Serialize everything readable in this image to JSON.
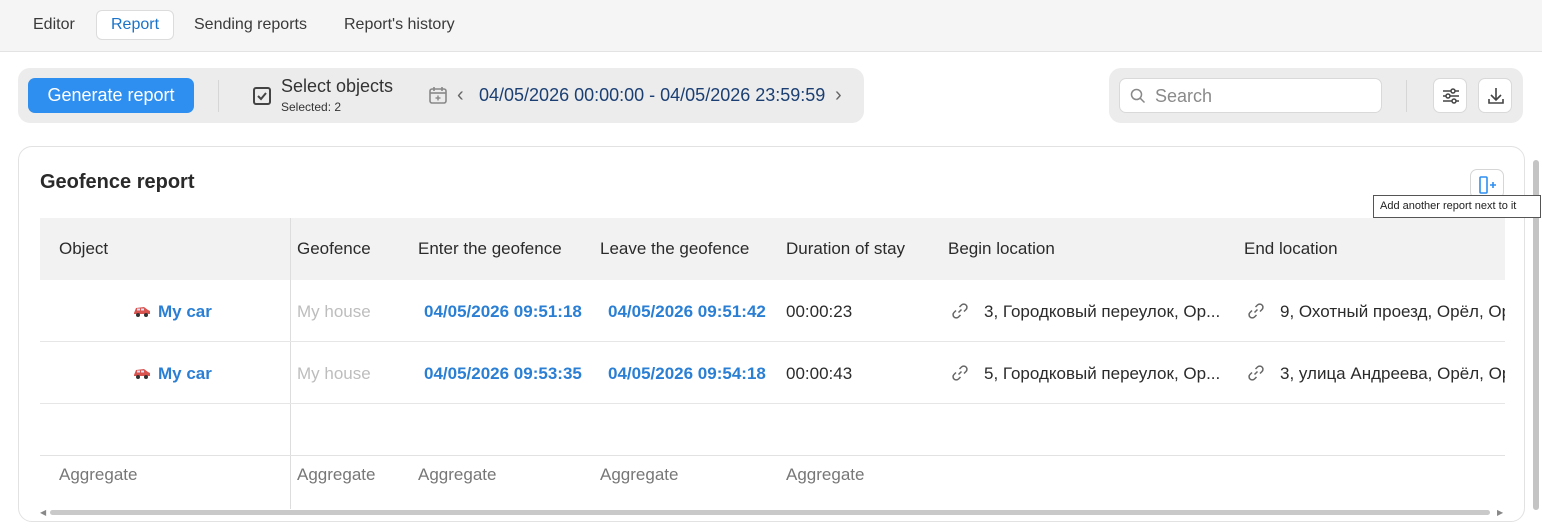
{
  "tabs": [
    {
      "label": "Editor",
      "active": false
    },
    {
      "label": "Report",
      "active": true
    },
    {
      "label": "Sending reports",
      "active": false
    },
    {
      "label": "Report's history",
      "active": false
    }
  ],
  "toolbar": {
    "generate_label": "Generate report",
    "select_objects_label": "Select objects",
    "selected_count_label": "Selected: 2",
    "period_label": "04/05/2026 00:00:00 - 04/05/2026 23:59:59",
    "search_placeholder": "Search",
    "accent_color": "#2e8ff0"
  },
  "report": {
    "title": "Geofence report",
    "add_tooltip": "Add another report next to it",
    "columns": [
      "Object",
      "Geofence",
      "Enter the geofence",
      "Leave the geofence",
      "Duration of stay",
      "Begin location",
      "End location"
    ],
    "rows": [
      {
        "object": "My car",
        "geofence": "My house",
        "enter": "04/05/2026 09:51:18",
        "leave": "04/05/2026 09:51:42",
        "duration": "00:00:23",
        "begin_location": "3, Городковый переулок, Ор...",
        "end_location": "9, Охотный проезд, Орёл, Ор"
      },
      {
        "object": "My car",
        "geofence": "My house",
        "enter": "04/05/2026 09:53:35",
        "leave": "04/05/2026 09:54:18",
        "duration": "00:00:43",
        "begin_location": "5, Городковый переулок, Ор...",
        "end_location": "3, улица Андреева, Орёл, Ор"
      }
    ],
    "aggregate_label": "Aggregate"
  },
  "icons": {
    "checkbox": "checkbox-checked-icon",
    "calendar": "calendar-icon",
    "prev": "chevron-left-icon",
    "next": "chevron-right-icon",
    "search": "search-icon",
    "settings": "sliders-icon",
    "download": "download-icon",
    "add_report": "add-column-icon",
    "car": "car-icon",
    "link": "link-icon"
  }
}
